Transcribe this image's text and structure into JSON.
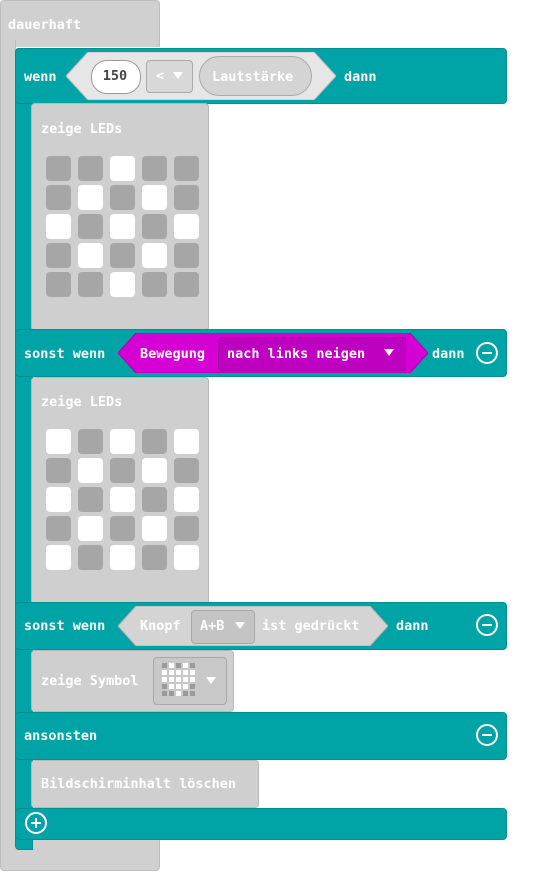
{
  "forever": {
    "label": "dauerhaft"
  },
  "if_block": {
    "wenn": "wenn",
    "value": "150",
    "operator": "<",
    "sensor": "Lautstärke",
    "dann": "dann"
  },
  "show_leds_1": {
    "label": "zeige LEDs",
    "grid": [
      [
        0,
        0,
        1,
        0,
        0
      ],
      [
        0,
        1,
        0,
        1,
        0
      ],
      [
        1,
        0,
        1,
        0,
        1
      ],
      [
        0,
        1,
        0,
        1,
        0
      ],
      [
        0,
        0,
        1,
        0,
        0
      ]
    ]
  },
  "elseif_1": {
    "label": "sonst wenn",
    "gesture": "Bewegung",
    "gesture_option": "nach links neigen",
    "dann": "dann"
  },
  "show_leds_2": {
    "label": "zeige LEDs",
    "grid": [
      [
        1,
        0,
        1,
        0,
        1
      ],
      [
        0,
        1,
        0,
        1,
        0
      ],
      [
        1,
        0,
        1,
        0,
        1
      ],
      [
        0,
        1,
        0,
        1,
        0
      ],
      [
        1,
        0,
        1,
        0,
        1
      ]
    ]
  },
  "elseif_2": {
    "label": "sonst wenn",
    "button_prefix": "Knopf",
    "button_option": "A+B",
    "pressed": "ist gedrückt",
    "dann": "dann"
  },
  "show_icon": {
    "label": "zeige Symbol",
    "icon": "heart-icon"
  },
  "else_block": {
    "label": "ansonsten"
  },
  "clear_screen": {
    "label": "Bildschirminhalt löschen"
  },
  "colors": {
    "logic": "#00a4a6",
    "input_gesture": "#d400d4",
    "basic": "#cfcfcf",
    "led_on": "#ffffff",
    "led_off": "#a6a6a6"
  }
}
